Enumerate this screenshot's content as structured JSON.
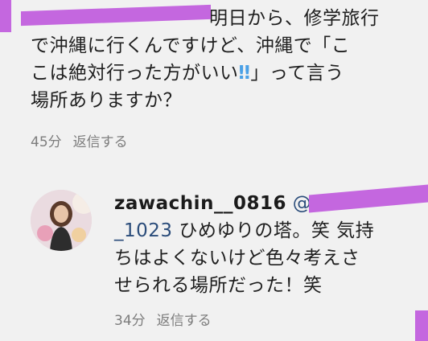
{
  "comment1": {
    "lines": [
      "明日から、修学旅行",
      "で沖縄に行くんですけど、沖縄で「こ",
      "こは絶対行った方がいい",
      "」って言う",
      "場所ありますか？"
    ],
    "emoji": "‼",
    "time": "45分",
    "reply": "返信する"
  },
  "comment2": {
    "username": "zawachin__0816",
    "mention_prefix": "@",
    "mention_suffix": "_1023",
    "line1_text": "ひめゆりの塔。笑 気持",
    "line2": "ちはよくないけど色々考えさ",
    "line3": "せられる場所だった！笑",
    "time": "34分",
    "reply": "返信する"
  },
  "colors": {
    "redaction": "#c467df",
    "meta": "#7d7d7d",
    "mention": "#2a4c7a"
  }
}
